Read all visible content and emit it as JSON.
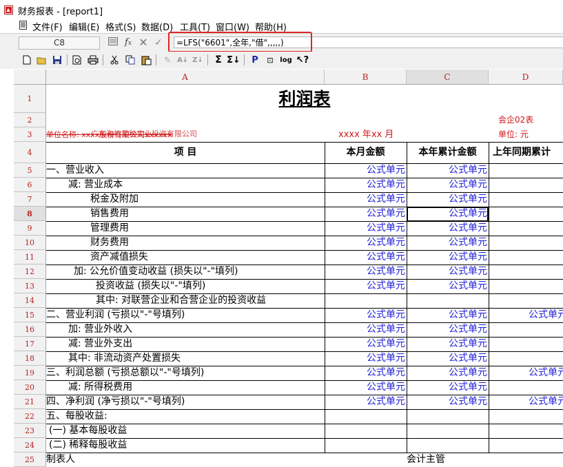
{
  "window": {
    "title": "财务报表 - [report1]"
  },
  "menu": [
    "文件(F)",
    "编辑(E)",
    "格式(S)",
    "数据(D)",
    "工具(T)",
    "窗口(W)",
    "帮助(H)"
  ],
  "formula_bar": {
    "cell_ref": "C8",
    "fx_icon": "fx-icon",
    "formula": "=LFS(\"6601\",全年,\"借\",,,,,)"
  },
  "columns": [
    "A",
    "B",
    "C",
    "D"
  ],
  "rows": [
    "1",
    "2",
    "3",
    "4",
    "5",
    "6",
    "7",
    "8",
    "9",
    "10",
    "11",
    "12",
    "13",
    "14",
    "15",
    "16",
    "17",
    "18",
    "19",
    "20",
    "21",
    "22",
    "23",
    "24",
    "25"
  ],
  "report": {
    "title": "利润表",
    "form_code": "会企02表",
    "unit_name": "单位名称: xxxx股份有限公司xxxxxx",
    "unit_name_overlay": "广东海行星种实业投资有限公司",
    "period": "xxxx 年xx 月",
    "currency_unit": "单位: 元",
    "header_item": "项          目",
    "header_b": "本月金额",
    "header_c": "本年累计金额",
    "header_d": "上年同期累计",
    "formula_label": "公式单元",
    "items": [
      "一、营业收入",
      "减: 营业成本",
      "税金及附加",
      "销售费用",
      "管理费用",
      "财务费用",
      "资产减值损失",
      "加: 公允价值变动收益 (损失以\"-\"填列)",
      "投资收益 (损失以\"-\"填列)",
      "其中: 对联营企业和合营企业的投资收益",
      "二、营业利润 (亏损以\"-\"号填列)",
      "加: 营业外收入",
      "减: 营业外支出",
      "其中: 非流动资产处置损失",
      "三、利润总额 (亏损总额以\"-\"号填列)",
      "减: 所得税费用",
      "四、净利润 (净亏损以\"-\"号填列)",
      "五、每股收益:",
      "(一) 基本每股收益",
      "(二) 稀释每股收益",
      "制表人"
    ],
    "footer_c": "会计主管"
  },
  "colors": {
    "formula_text": "#1f1fd8",
    "red_text": "#d01818",
    "header_text": "#b4231e",
    "highlight": "#e02525"
  }
}
